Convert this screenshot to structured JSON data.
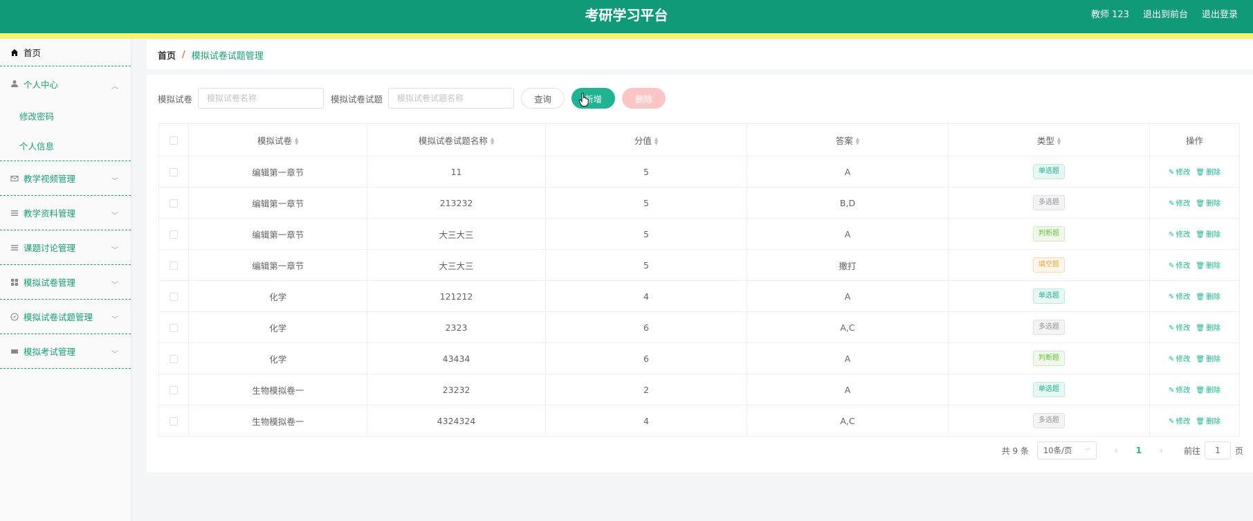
{
  "header": {
    "title": "考研学习平台",
    "user": "教师 123",
    "front_link": "退出到前台",
    "logout": "退出登录"
  },
  "sidebar": {
    "home": "首页",
    "personal": "个人中心",
    "personal_sub": [
      "修改密码",
      "个人信息"
    ],
    "items": [
      "教学视频管理",
      "教学资料管理",
      "课题讨论管理",
      "模拟试卷管理",
      "模拟试卷试题管理",
      "模拟考试管理"
    ]
  },
  "breadcrumb": {
    "home": "首页",
    "sep": "/",
    "current": "模拟试卷试题管理"
  },
  "filters": {
    "label1": "模拟试卷",
    "placeholder1": "模拟试卷名称",
    "label2": "模拟试卷试题",
    "placeholder2": "模拟试卷试题名称",
    "query": "查询",
    "add": "新增",
    "delete": "删除"
  },
  "table": {
    "columns": [
      "模拟试卷",
      "模拟试卷试题名称",
      "分值",
      "答案",
      "类型",
      "操作"
    ],
    "edit_label": "修改",
    "delete_label": "删除",
    "rows": [
      {
        "paper": "编辑第一章节",
        "name": "11",
        "score": "5",
        "answer": "A",
        "type": "单选题",
        "kind": "single"
      },
      {
        "paper": "编辑第一章节",
        "name": "213232",
        "score": "5",
        "answer": "B,D",
        "type": "多选题",
        "kind": "multi"
      },
      {
        "paper": "编辑第一章节",
        "name": "大三大三",
        "score": "5",
        "answer": "A",
        "type": "判断题",
        "kind": "judge"
      },
      {
        "paper": "编辑第一章节",
        "name": "大三大三",
        "score": "5",
        "answer": "撒打",
        "type": "填空题",
        "kind": "fill"
      },
      {
        "paper": "化学",
        "name": "121212",
        "score": "4",
        "answer": "A",
        "type": "单选题",
        "kind": "single"
      },
      {
        "paper": "化学",
        "name": "2323",
        "score": "6",
        "answer": "A,C",
        "type": "多选题",
        "kind": "multi"
      },
      {
        "paper": "化学",
        "name": "43434",
        "score": "6",
        "answer": "A",
        "type": "判断题",
        "kind": "judge"
      },
      {
        "paper": "生物模拟卷一",
        "name": "23232",
        "score": "2",
        "answer": "A",
        "type": "单选题",
        "kind": "single"
      },
      {
        "paper": "生物模拟卷一",
        "name": "4324324",
        "score": "4",
        "answer": "A,C",
        "type": "多选题",
        "kind": "multi"
      }
    ]
  },
  "pagination": {
    "total": "共 9 条",
    "page_size": "10条/页",
    "current_page": "1",
    "goto_label": "前往",
    "goto_value": "1",
    "page_suffix": "页"
  },
  "colors": {
    "header": "#119a78",
    "stripe": "#f5f26d",
    "accent": "#1fb293"
  }
}
